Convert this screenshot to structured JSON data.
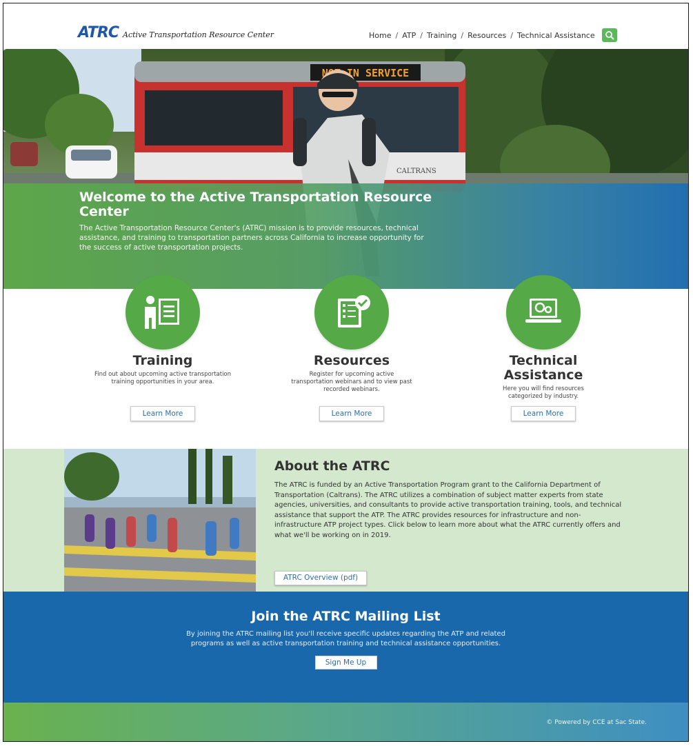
{
  "header": {
    "logo_mark": "ATRC",
    "logo_text": "Active Transportation Resource Center",
    "nav": [
      "Home",
      "ATP",
      "Training",
      "Resources",
      "Technical Assistance"
    ],
    "nav_separator": "/",
    "search_icon": "search-icon"
  },
  "hero": {
    "title": "Welcome to the Active Transportation Resource Center",
    "description": "The Active Transportation Resource Center's (ATRC) mission is to provide resources, technical assistance, and training to transportation partners across California to increase opportunity for the success of active transportation projects.",
    "bus_sign": "NOT IN SERVICE",
    "bus_lettering": "CALTRANS"
  },
  "features": [
    {
      "icon": "presentation-icon",
      "title": "Training",
      "description": "Find out about upcoming active transportation training opportunities in your area.",
      "button": "Learn More"
    },
    {
      "icon": "checklist-icon",
      "title": "Resources",
      "description": "Register for upcoming active transportation webinars and to view past recorded webinars.",
      "button": "Learn More"
    },
    {
      "icon": "gears-laptop-icon",
      "title": "Technical Assistance",
      "description": "Here you will find resources categorized by industry.",
      "button": "Learn More"
    }
  ],
  "about": {
    "title": "About the ATRC",
    "text": "The ATRC is funded by an Active Transportation  Program grant to the California Department of Transportation (Caltrans). The ATRC utilizes a combination of subject matter experts from state agencies, universities, and consultants to provide active transportation training, tools, and technical assistance that support the ATP. The ATRC provides resources for infrastructure and non-infrastructure ATP project types. Click below to learn more about what the ATRC currently offers and what we'll be working on in 2019.",
    "button": "ATRC Overview (pdf)"
  },
  "mailing": {
    "title": "Join the ATRC Mailing List",
    "description": "By joining the ATRC mailing list you'll receive specific updates regarding the ATP and related programs as well as active transportation training and technical assistance opportunities.",
    "button": "Sign Me Up"
  },
  "footer": {
    "text": "© Powered by CCE at Sac State."
  },
  "colors": {
    "brand_blue": "#1f58a8",
    "brand_green": "#56a947",
    "mailing_blue": "#1a68ac",
    "about_bg": "#d3e8cd"
  }
}
